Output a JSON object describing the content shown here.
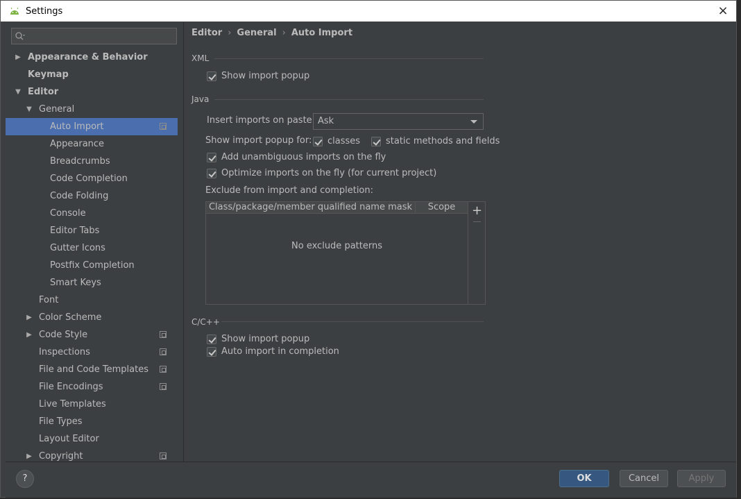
{
  "window": {
    "title": "Settings",
    "close_glyph": "×"
  },
  "search": {
    "placeholder": ""
  },
  "sidebar": {
    "items": [
      {
        "label": "Appearance & Behavior",
        "bold": true,
        "arrow": "right",
        "indent": 0
      },
      {
        "label": "Keymap",
        "bold": true,
        "arrow": "",
        "indent": 0
      },
      {
        "label": "Editor",
        "bold": true,
        "arrow": "down",
        "indent": 0
      },
      {
        "label": "General",
        "bold": false,
        "arrow": "down",
        "indent": 1
      },
      {
        "label": "Auto Import",
        "bold": false,
        "arrow": "",
        "indent": 2,
        "selected": true,
        "project": true
      },
      {
        "label": "Appearance",
        "bold": false,
        "arrow": "",
        "indent": 2
      },
      {
        "label": "Breadcrumbs",
        "bold": false,
        "arrow": "",
        "indent": 2
      },
      {
        "label": "Code Completion",
        "bold": false,
        "arrow": "",
        "indent": 2
      },
      {
        "label": "Code Folding",
        "bold": false,
        "arrow": "",
        "indent": 2
      },
      {
        "label": "Console",
        "bold": false,
        "arrow": "",
        "indent": 2
      },
      {
        "label": "Editor Tabs",
        "bold": false,
        "arrow": "",
        "indent": 2
      },
      {
        "label": "Gutter Icons",
        "bold": false,
        "arrow": "",
        "indent": 2
      },
      {
        "label": "Postfix Completion",
        "bold": false,
        "arrow": "",
        "indent": 2
      },
      {
        "label": "Smart Keys",
        "bold": false,
        "arrow": "",
        "indent": 2
      },
      {
        "label": "Font",
        "bold": false,
        "arrow": "",
        "indent": 1
      },
      {
        "label": "Color Scheme",
        "bold": false,
        "arrow": "right",
        "indent": 1
      },
      {
        "label": "Code Style",
        "bold": false,
        "arrow": "right",
        "indent": 1,
        "project": true
      },
      {
        "label": "Inspections",
        "bold": false,
        "arrow": "",
        "indent": 1,
        "project": true
      },
      {
        "label": "File and Code Templates",
        "bold": false,
        "arrow": "",
        "indent": 1,
        "project": true
      },
      {
        "label": "File Encodings",
        "bold": false,
        "arrow": "",
        "indent": 1,
        "project": true
      },
      {
        "label": "Live Templates",
        "bold": false,
        "arrow": "",
        "indent": 1
      },
      {
        "label": "File Types",
        "bold": false,
        "arrow": "",
        "indent": 1
      },
      {
        "label": "Layout Editor",
        "bold": false,
        "arrow": "",
        "indent": 1
      },
      {
        "label": "Copyright",
        "bold": false,
        "arrow": "right",
        "indent": 1,
        "project": true
      }
    ]
  },
  "breadcrumb": {
    "items": [
      "Editor",
      "General",
      "Auto Import"
    ],
    "separator": "›"
  },
  "xml": {
    "section": "XML",
    "show_import_popup": {
      "label": "Show import popup",
      "checked": true
    }
  },
  "java": {
    "section": "Java",
    "insert_imports_label": "Insert imports on paste:",
    "insert_imports_value": "Ask",
    "show_popup_for_label": "Show import popup for:",
    "classes": {
      "label": "classes",
      "checked": true
    },
    "static_methods": {
      "label": "static methods and fields",
      "checked": true
    },
    "add_unambiguous": {
      "label": "Add unambiguous imports on the fly",
      "checked": true
    },
    "optimize_imports": {
      "label": "Optimize imports on the fly (for current project)",
      "checked": true
    },
    "exclude_label": "Exclude from import and completion:",
    "table": {
      "columns": [
        "Class/package/member qualified name mask",
        "Scope"
      ],
      "empty_text": "No exclude patterns",
      "add_glyph": "+"
    }
  },
  "cpp": {
    "section": "C/C++",
    "show_import_popup": {
      "label": "Show import popup",
      "checked": true
    },
    "auto_import": {
      "label": "Auto import in completion",
      "checked": true
    }
  },
  "footer": {
    "help_glyph": "?",
    "ok": "OK",
    "cancel": "Cancel",
    "apply": "Apply"
  },
  "colors": {
    "selection": "#4b6eaf",
    "ok_button": "#365880",
    "background": "#3c3f41"
  }
}
